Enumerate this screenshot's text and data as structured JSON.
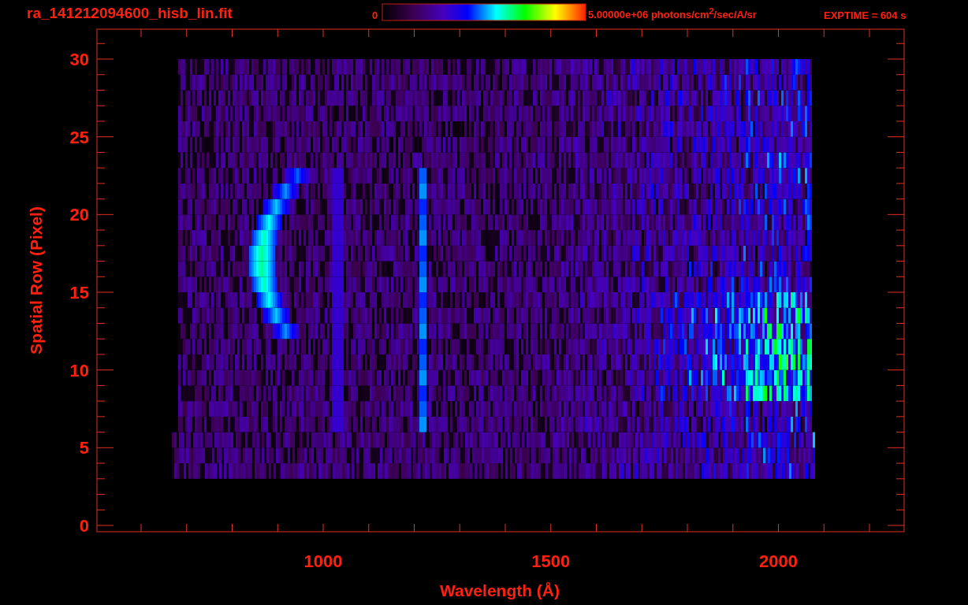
{
  "title": "ra_141212094600_hisb_lin.fit",
  "colorbar": {
    "min_label": "0",
    "max_label": "5.00000e+06 photons/cm$^{2}$/sec/A/sr"
  },
  "exposure": "EXPTIME = 604 s",
  "plot": {
    "xlabel": "Wavelength (Å)",
    "ylabel": "Spatial Row (Pixel)",
    "xticks": [
      "1000",
      "1500",
      "2000"
    ],
    "yticks": [
      "30",
      "25",
      "20",
      "15",
      "10",
      "5",
      "0"
    ]
  }
}
